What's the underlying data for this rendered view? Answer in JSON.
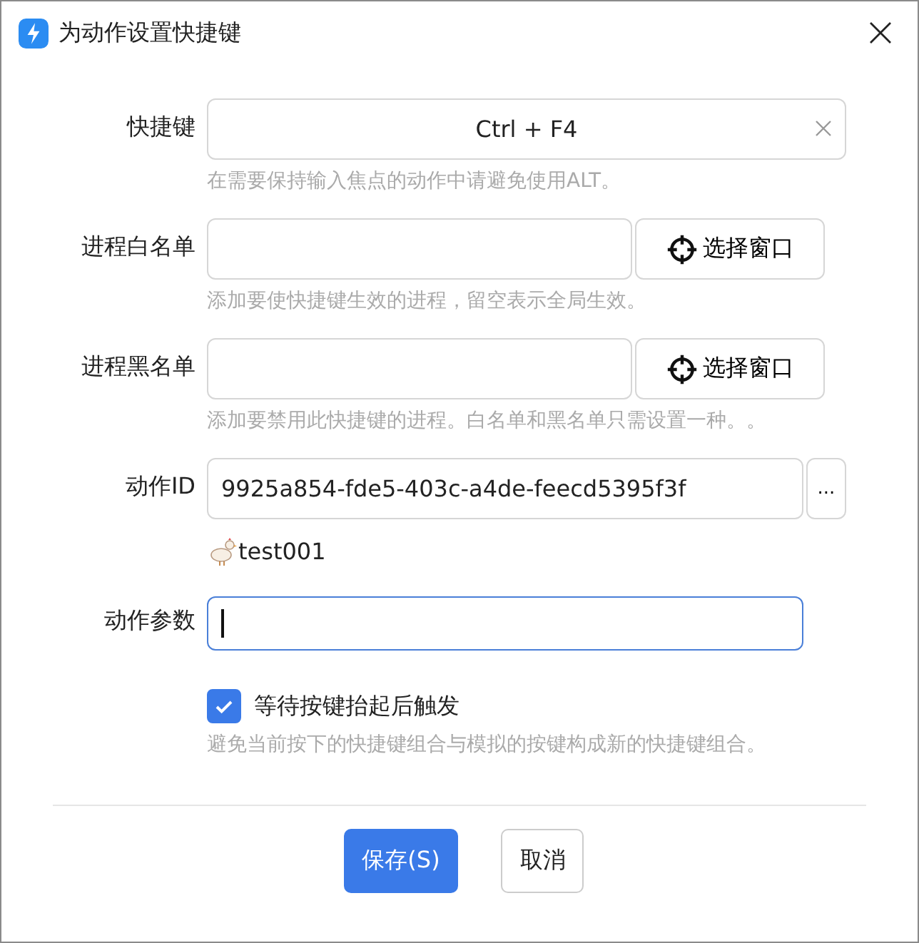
{
  "window": {
    "title": "为动作设置快捷键"
  },
  "fields": [
    {
      "kind": "shortcut",
      "label": "快捷键",
      "value": "Ctrl + F4",
      "hint": "在需要保持输入焦点的动作中请避免使用ALT。"
    },
    {
      "kind": "picker",
      "label": "进程白名单",
      "button": "选择窗口",
      "hint": "添加要使快捷键生效的进程，留空表示全局生效。"
    },
    {
      "kind": "picker",
      "label": "进程黑名单",
      "button": "选择窗口",
      "hint": "添加要禁用此快捷键的进程。白名单和黑名单只需设置一种。。"
    },
    {
      "kind": "id",
      "label": "动作ID",
      "value": "9925a854-fde5-403c-a4de-feecd5395f3f",
      "button": "...",
      "caption": "test001"
    },
    {
      "kind": "text",
      "label": "动作参数",
      "focused": true
    }
  ],
  "checkbox": {
    "label": "等待按键抬起后触发",
    "checked": true,
    "hint": "避免当前按下的快捷键组合与模拟的按键构成新的快捷键组合。"
  },
  "buttons": [
    {
      "label": "保存(S)",
      "primary": true
    },
    {
      "label": "取消",
      "primary": false
    }
  ]
}
